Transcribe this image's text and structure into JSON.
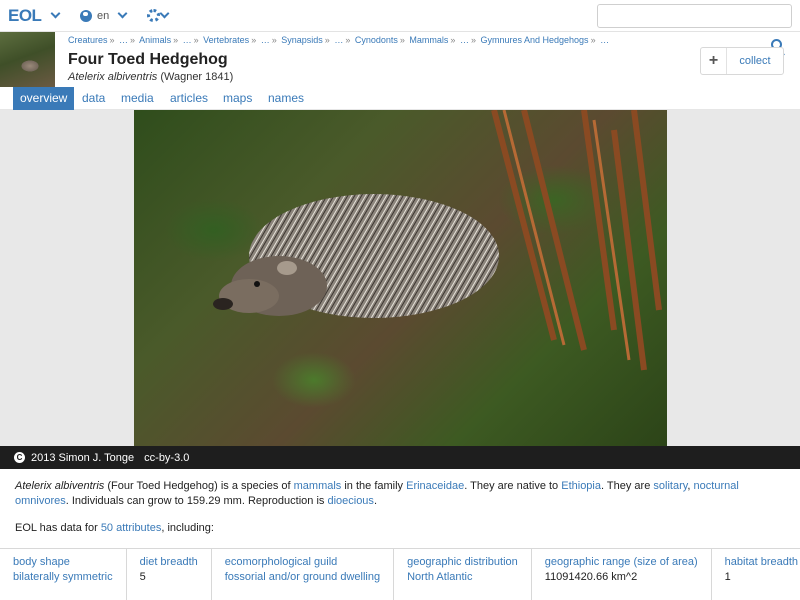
{
  "topbar": {
    "logo": "EOL",
    "language": "en",
    "search_value": ""
  },
  "header": {
    "breadcrumb": [
      "Creatures",
      "…",
      "Animals",
      "…",
      "Vertebrates",
      "…",
      "Synapsids",
      "…",
      "Cynodonts",
      "Mammals",
      "…",
      "Gymnures And Hedgehogs",
      "…"
    ],
    "title": "Four Toed Hedgehog",
    "scientific_name": "Atelerix albiventris",
    "authority": "(Wagner 1841)",
    "collect_label": "collect"
  },
  "tabs": [
    "overview",
    "data",
    "media",
    "articles",
    "maps",
    "names"
  ],
  "photo": {
    "credit": "2013 Simon J. Tonge",
    "license": "cc-by-3.0"
  },
  "description": {
    "sci": "Atelerix albiventris",
    "t1": " (Four Toed Hedgehog) is a species of ",
    "l1": "mammals",
    "t2": " in the family ",
    "l2": "Erinaceidae",
    "t3": ". They are native to ",
    "l3": "Ethiopia",
    "t4": ". They are ",
    "l4": "solitary",
    "t5": ", ",
    "l5": "nocturnal omnivores",
    "t6": ". Individuals can grow to 159.29 mm. Reproduction is ",
    "l6": "dioecious",
    "t7": "."
  },
  "attr_summary": {
    "pre": "EOL has data for ",
    "link": "50 attributes",
    "post": ", including:"
  },
  "attributes": [
    {
      "key": "body shape",
      "value": "bilaterally symmetric"
    },
    {
      "key": "diet breadth",
      "value": "5"
    },
    {
      "key": "ecomorphological guild",
      "value": "fossorial and/or ground dwelling"
    },
    {
      "key": "geographic distribution",
      "value": "North Atlantic"
    },
    {
      "key": "geographic range (size of area)",
      "value": "11091420.66 km^2"
    },
    {
      "key": "habitat breadth",
      "value": "1"
    }
  ],
  "colors": {
    "accent": "#3a7ab8",
    "caption_bg": "#1e1e1e"
  }
}
